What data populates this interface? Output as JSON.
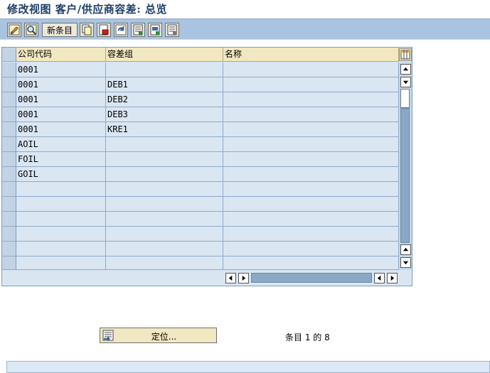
{
  "window": {
    "title": "修改视图 客户/供应商容差: 总览"
  },
  "toolbar": {
    "new_entries_label": "新条目",
    "icons": [
      "edit-toggle-icon",
      "display-icon",
      "copy-icon",
      "delete-icon",
      "undo-icon",
      "select-all-icon",
      "select-block-icon",
      "deselect-all-icon"
    ]
  },
  "table": {
    "columns": [
      "公司代码",
      "容差组",
      "名称"
    ],
    "rows": [
      [
        "0001",
        "",
        ""
      ],
      [
        "0001",
        "DEB1",
        ""
      ],
      [
        "0001",
        "DEB2",
        ""
      ],
      [
        "0001",
        "DEB3",
        ""
      ],
      [
        "0001",
        "KRE1",
        ""
      ],
      [
        "AOIL",
        "",
        ""
      ],
      [
        "FOIL",
        "",
        ""
      ],
      [
        "GOIL",
        "",
        ""
      ],
      [
        "",
        "",
        ""
      ],
      [
        "",
        "",
        ""
      ],
      [
        "",
        "",
        ""
      ],
      [
        "",
        "",
        ""
      ],
      [
        "",
        "",
        ""
      ],
      [
        "",
        "",
        ""
      ]
    ]
  },
  "footer": {
    "position_button_label": "定位...",
    "entry_count_text": "条目 1 的 8"
  },
  "colors": {
    "title_text": "#1d3f66",
    "toolbar_bg": "#a9c4e0",
    "header_bg": "#f1e7c1",
    "cell_bg": "#dae6f2"
  }
}
